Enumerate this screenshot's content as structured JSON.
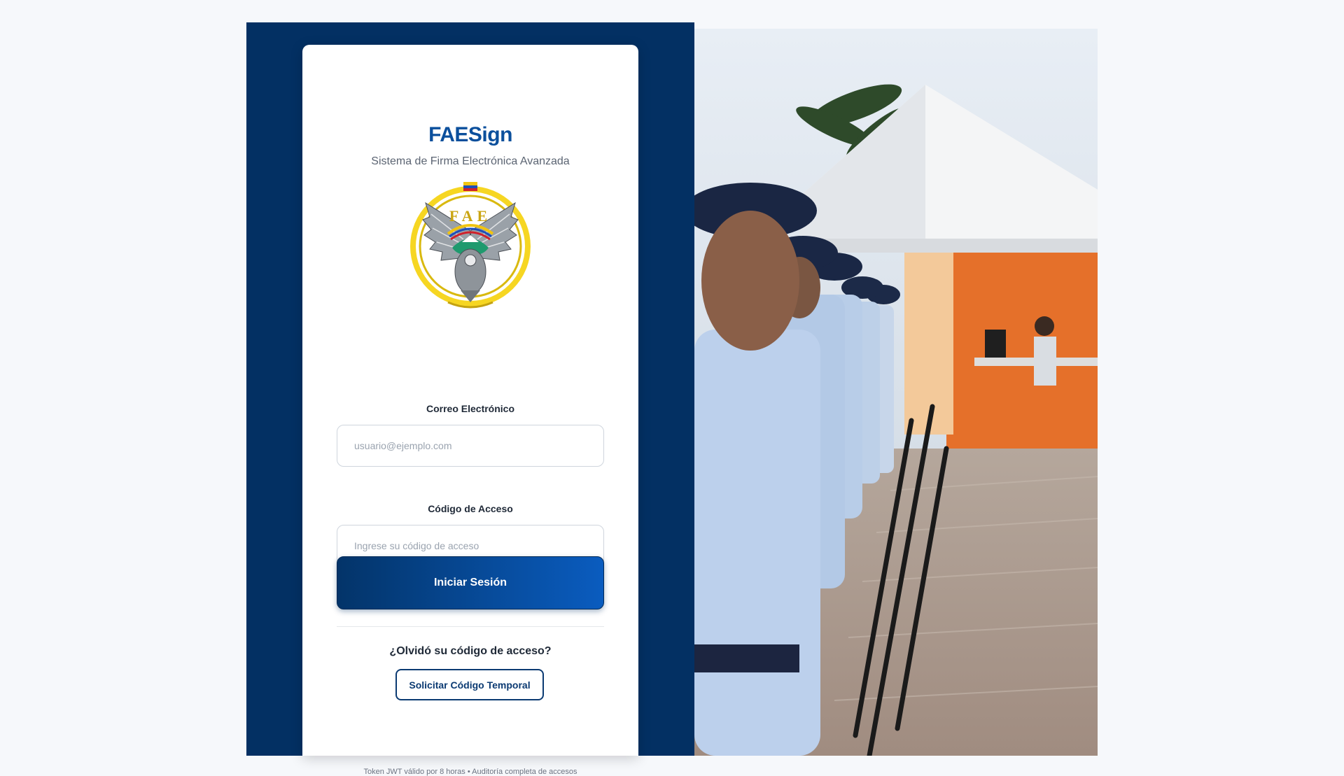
{
  "brand": {
    "title": "FAESign",
    "subtitle": "Sistema de Firma Electrónica Avanzada",
    "logo_text": "FAE"
  },
  "form": {
    "email_label": "Correo Electrónico",
    "email_placeholder": "usuario@ejemplo.com",
    "code_label": "Código de Acceso",
    "code_placeholder": "Ingrese su código de acceso",
    "submit_label": "Iniciar Sesión"
  },
  "recovery": {
    "question": "¿Olvidó su código de acceso?",
    "button_label": "Solicitar Código Temporal"
  },
  "footer": {
    "note": "Token JWT válido por 8 horas • Auditoría completa de accesos"
  },
  "colors": {
    "brand_blue": "#0b4f9c",
    "panel_navy": "#033063",
    "button_gradient_start": "#033469",
    "button_gradient_end": "#0a5cbf"
  }
}
